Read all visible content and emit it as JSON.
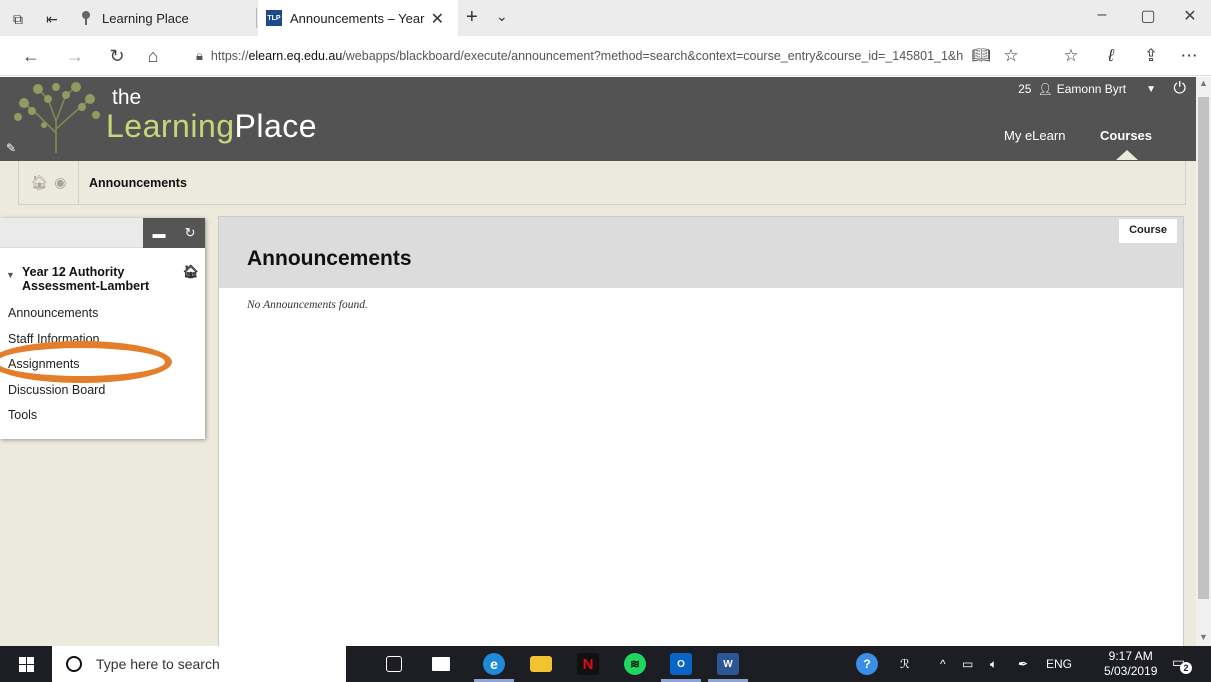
{
  "browser": {
    "tabs": [
      {
        "title": "Learning Place"
      },
      {
        "title": "Announcements – Year",
        "favicon": "TLP"
      }
    ],
    "url": {
      "scheme": "https://",
      "host": "elearn.eq.edu.au",
      "path": "/webapps/blackboard/execute/announcement?method=search&context=course_entry&course_id=_145801_1&h"
    }
  },
  "header": {
    "logo_the": "the",
    "logo_learning": "Learning",
    "logo_place": "Place",
    "notifications_count": "25",
    "user_name": "Eamonn Byrt",
    "nav": {
      "my_elearn": "My eLearn",
      "courses": "Courses"
    },
    "colors": {
      "bar": "#535353",
      "accent": "#c6d77a"
    }
  },
  "breadcrumb": {
    "current": "Announcements"
  },
  "course_menu": {
    "course_title_line1": "Year 12 Authority",
    "course_title_line2": "Assessment-Lambert",
    "items": [
      {
        "label": "Announcements"
      },
      {
        "label": "Staff Information"
      },
      {
        "label": "Assignments"
      },
      {
        "label": "Discussion Board"
      },
      {
        "label": "Tools"
      }
    ],
    "highlighted_item": "Assignments",
    "highlight_color": "#e57e2a"
  },
  "content": {
    "title": "Announcements",
    "mode_tab": "Course",
    "empty_message": "No Announcements found."
  },
  "taskbar": {
    "search_placeholder": "Type here to search",
    "language": "ENG",
    "time": "9:17 AM",
    "date": "5/03/2019",
    "notification_badge": "2"
  }
}
